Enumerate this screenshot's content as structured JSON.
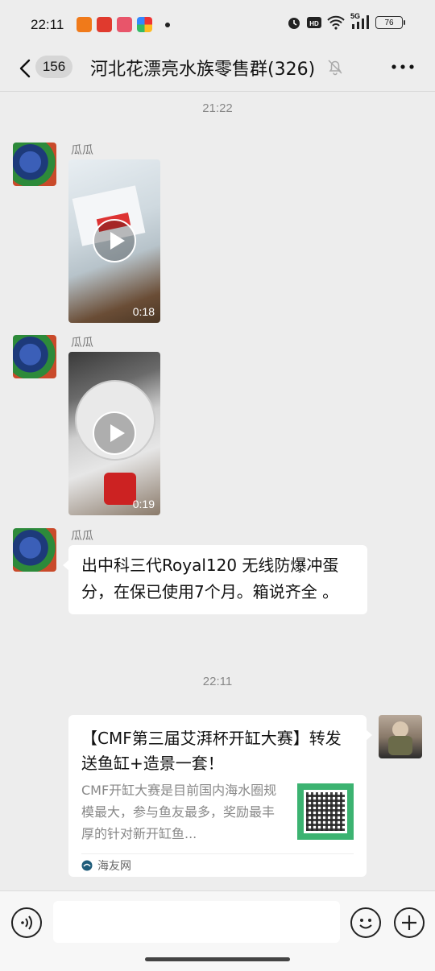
{
  "status_bar": {
    "time": "22:11",
    "network": "5G",
    "battery": "76",
    "app_icons": [
      "app-icon-orange",
      "app-icon-red",
      "app-icon-pink",
      "app-icon-browser"
    ],
    "right_icons": [
      "alarm-icon",
      "hd-icon",
      "wifi-icon",
      "signal-icon",
      "battery-icon"
    ]
  },
  "nav": {
    "unread_count": "156",
    "title": "河北花漂亮水族零售群(326)",
    "icons": [
      "back-icon",
      "mute-bell-icon",
      "more-icon"
    ]
  },
  "messages": [
    {
      "type": "timestamp",
      "text": "21:22"
    },
    {
      "type": "video",
      "sender": "瓜瓜",
      "duration": "0:18"
    },
    {
      "type": "video",
      "sender": "瓜瓜",
      "duration": "0:19"
    },
    {
      "type": "text",
      "sender": "瓜瓜",
      "text": "出中科三代Royal120 无线防爆冲蛋分，在保已使用7个月。箱说齐全 。"
    },
    {
      "type": "timestamp",
      "text": "22:11"
    },
    {
      "type": "link_card",
      "title": "【CMF第三届艾湃杯开缸大赛】转发送鱼缸+造景一套！",
      "description": "CMF开缸大赛是目前国内海水圈规模最大，参与鱼友最多，奖励最丰厚的针对新开缸鱼...",
      "source": "海友网"
    }
  ],
  "input_bar": {
    "icons": [
      "voice-icon",
      "emoji-icon",
      "plus-icon"
    ]
  },
  "colors": {
    "background": "#ededed",
    "bubble": "#ffffff",
    "timestamp_text": "#888888",
    "qr_green": "#3cb371"
  }
}
